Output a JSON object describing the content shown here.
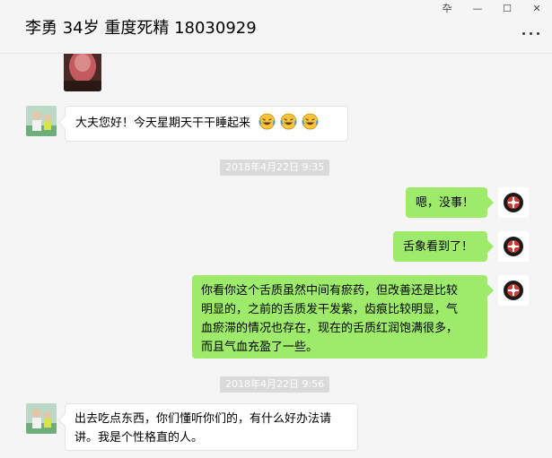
{
  "window": {
    "title": "李勇 34岁 重度死精 18030929",
    "pin_glyph": "卆",
    "minimize_glyph": "—",
    "maximize_glyph": "☐",
    "close_glyph": "✕"
  },
  "colors": {
    "background": "#f5f5f5",
    "outgoing_bubble": "#9eea6a",
    "incoming_bubble": "#ffffff",
    "timestamp_bg": "#dadada"
  },
  "messages": [
    {
      "type": "image",
      "direction": "in",
      "content": "tongue-photo"
    },
    {
      "type": "text",
      "direction": "in",
      "text": "大夫您好！今天星期天干干睡起来",
      "emoji_count": 3,
      "emoji": "laugh-cry-emoji"
    },
    {
      "type": "timestamp",
      "text": "2018年4月22日 9:35"
    },
    {
      "type": "text",
      "direction": "out",
      "text": "嗯，没事！"
    },
    {
      "type": "text",
      "direction": "out",
      "text": "舌象看到了！"
    },
    {
      "type": "text",
      "direction": "out",
      "lines": [
        "你看你这个舌质虽然中间有瘀药，但改善还是比较",
        "明显的，之前的舌质发干发紫，齿痕比较明显，气",
        "血瘀滞的情况也存在，现在的舌质红润饱满很多，",
        "而且气血充盈了一些。"
      ]
    },
    {
      "type": "timestamp",
      "text": "2018年4月22日 9:56"
    },
    {
      "type": "text",
      "direction": "in",
      "lines": [
        "出去吃点东西，你们懂听你们的，有什么好办法请",
        "讲。我是个性格直的人。"
      ]
    }
  ]
}
